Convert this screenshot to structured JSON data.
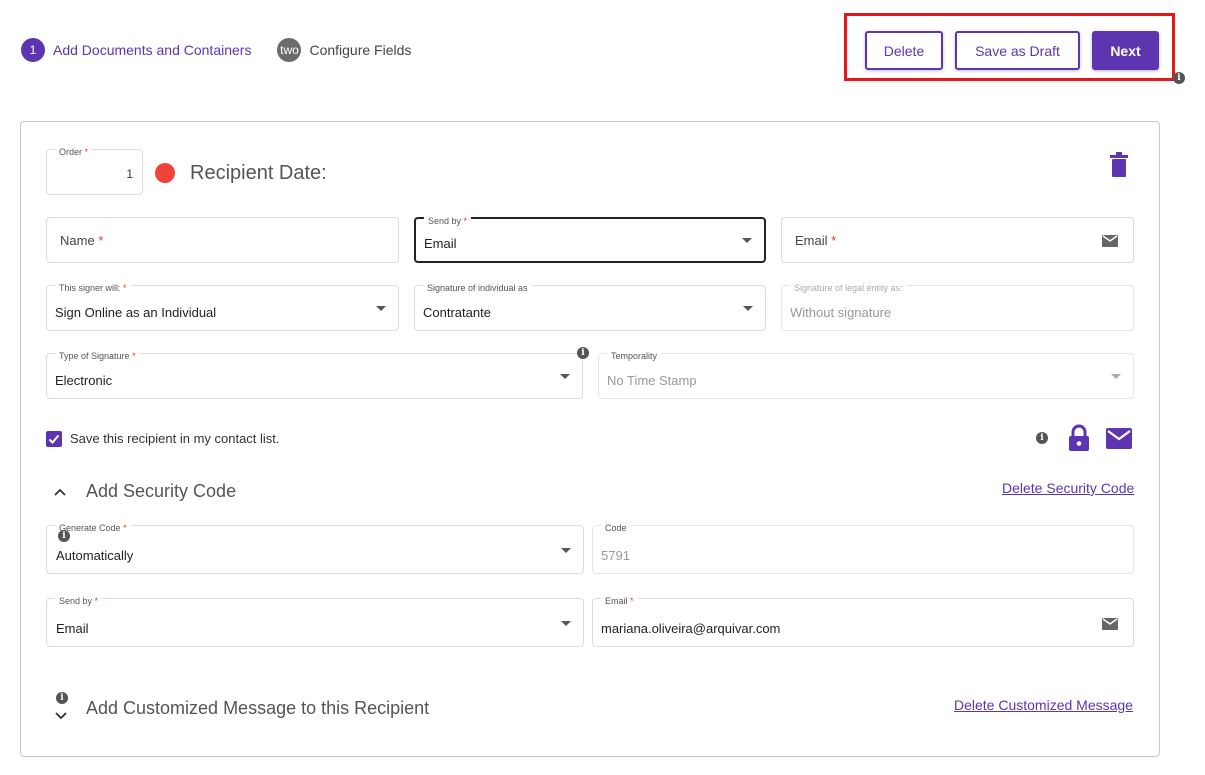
{
  "stepper": {
    "steps": [
      {
        "number": "1",
        "label": "Add Documents and Containers"
      },
      {
        "number": "two",
        "label": "Configure Fields"
      }
    ]
  },
  "actions": {
    "delete": "Delete",
    "save_draft": "Save as Draft",
    "next": "Next"
  },
  "recipient": {
    "order_label": "Order",
    "order_value": "1",
    "title": "Recipient Date:",
    "name_placeholder": "Name",
    "send_by_label": "Send by",
    "send_by_value": "Email",
    "email_placeholder": "Email",
    "signer_will_label": "This signer will:",
    "signer_will_value": "Sign Online as an Individual",
    "sig_individual_label": "Signature of individual as",
    "sig_individual_value": "Contratante",
    "sig_legal_label": "Signature of legal entity as:",
    "sig_legal_value": "Without signature",
    "sig_type_label": "Type of Signature",
    "sig_type_value": "Electronic",
    "temporality_label": "Temporality",
    "temporality_value": "No Time Stamp",
    "save_contact_label": "Save this recipient in my contact list."
  },
  "security": {
    "title": "Add Security Code",
    "delete_link": "Delete Security Code",
    "generate_label": "Generate Code",
    "generate_value": "Automatically",
    "code_label": "Code",
    "code_value": "5791",
    "send_by_label": "Send by",
    "send_by_value": "Email",
    "email_label": "Email",
    "email_value": "mariana.oliveira@arquivar.com"
  },
  "message": {
    "title": "Add Customized Message to this Recipient",
    "delete_link": "Delete Customized Message"
  },
  "colors": {
    "accent": "#5d35b0",
    "highlight": "#e8151b",
    "status_dot": "#f0443a"
  }
}
